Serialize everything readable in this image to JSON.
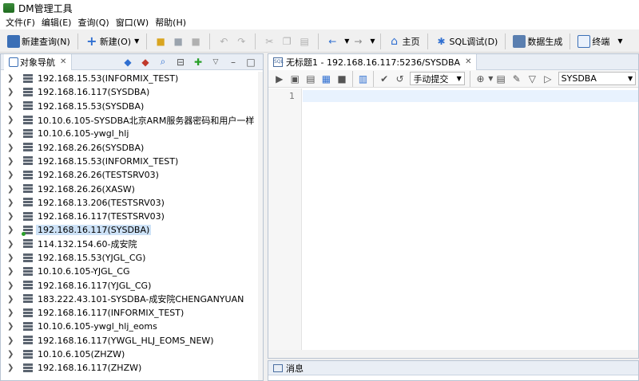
{
  "window": {
    "title": "DM管理工具"
  },
  "menu": [
    "文件(F)",
    "编辑(E)",
    "查询(Q)",
    "窗口(W)",
    "帮助(H)"
  ],
  "toolbar": {
    "new_query": "新建查询(N)",
    "new": "新建(O)",
    "home": "主页",
    "sql_debug": "SQL调试(D)",
    "data_gen": "数据生成",
    "terminal": "终端"
  },
  "navigator": {
    "tab_title": "对象导航",
    "items": [
      {
        "label": "192.168.15.53(INFORMIX_TEST)",
        "selected": false
      },
      {
        "label": "192.168.16.117(SYSDBA)",
        "selected": false
      },
      {
        "label": "192.168.15.53(SYSDBA)",
        "selected": false
      },
      {
        "label": "10.10.6.105-SYSDBA北京ARM服务器密码和用户一样",
        "selected": false
      },
      {
        "label": "10.10.6.105-ywgl_hlj",
        "selected": false
      },
      {
        "label": "192.168.26.26(SYSDBA)",
        "selected": false
      },
      {
        "label": "192.168.15.53(INFORMIX_TEST)",
        "selected": false
      },
      {
        "label": "192.168.26.26(TESTSRV03)",
        "selected": false
      },
      {
        "label": "192.168.26.26(XASW)",
        "selected": false
      },
      {
        "label": "192.168.13.206(TESTSRV03)",
        "selected": false
      },
      {
        "label": "192.168.16.117(TESTSRV03)",
        "selected": false
      },
      {
        "label": "192.168.16.117(SYSDBA)",
        "selected": true
      },
      {
        "label": "114.132.154.60-成安院",
        "selected": false
      },
      {
        "label": "192.168.15.53(YJGL_CG)",
        "selected": false
      },
      {
        "label": "10.10.6.105-YJGL_CG",
        "selected": false
      },
      {
        "label": "192.168.16.117(YJGL_CG)",
        "selected": false
      },
      {
        "label": "183.222.43.101-SYSDBA-成安院CHENGANYUAN",
        "selected": false
      },
      {
        "label": "192.168.16.117(INFORMIX_TEST)",
        "selected": false
      },
      {
        "label": "10.10.6.105-ywgl_hlj_eoms",
        "selected": false
      },
      {
        "label": "192.168.16.117(YWGL_HLJ_EOMS_NEW)",
        "selected": false
      },
      {
        "label": "10.10.6.105(ZHZW)",
        "selected": false
      },
      {
        "label": "192.168.16.117(ZHZW)",
        "selected": false
      }
    ]
  },
  "editor": {
    "tab_title": "无标题1 - 192.168.16.117:5236/SYSDBA",
    "commit_mode": "手动提交",
    "schema": "SYSDBA",
    "line_number": "1"
  },
  "messages": {
    "tab_title": "消息"
  },
  "colors": {
    "selection": "#cde2f7",
    "connected_dot": "#2aa02a",
    "accent": "#2f6fd1"
  }
}
